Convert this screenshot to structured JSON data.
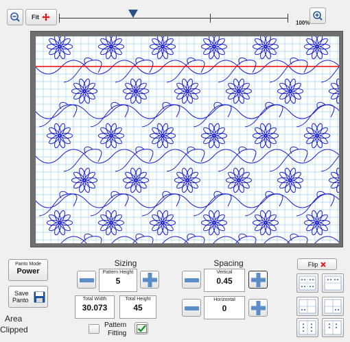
{
  "zoom_toolbar": {
    "zoom_out_icon": "zoom-out-icon",
    "fit_label": "Fit",
    "zoom_percent_label": "100%",
    "zoom_in_icon": "zoom-in-icon",
    "slider_level_fraction": 0.35
  },
  "canvas": {
    "background_color": "#ffffff",
    "grid_color": "#9fd4f2",
    "pattern_color": "#1a1acc",
    "boundary_line_color": "#ff0000"
  },
  "left_panel": {
    "panto_mode_label": "Panto Mode",
    "panto_mode_value": "Power",
    "save_panto_label_line1": "Save",
    "save_panto_label_line2": "Panto",
    "area_label": "Area",
    "clipped_label": "Clipped"
  },
  "sizing": {
    "title": "Sizing",
    "pattern_height_label": "Pattern Height",
    "pattern_height_value": "5",
    "total_width_label": "Total Width",
    "total_width_value": "30.073",
    "total_height_label": "Total Height",
    "total_height_value": "45",
    "pattern_fitting_label_line1": "Pattern",
    "pattern_fitting_label_line2": "Fitting"
  },
  "spacing": {
    "title": "Spacing",
    "vertical_label": "Vertical",
    "vertical_value": "0.45",
    "horizontal_label": "Horizontal",
    "horizontal_value": "0"
  },
  "flip": {
    "label": "Flip",
    "icon": "x-icon"
  }
}
